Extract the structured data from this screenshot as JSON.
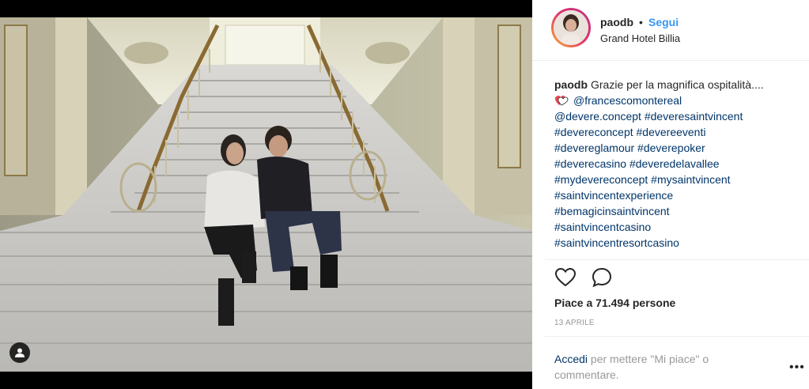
{
  "post": {
    "username": "paodb",
    "separator": "•",
    "follow_label": "Segui",
    "location": "Grand Hotel Billia"
  },
  "caption": {
    "username": "paodb",
    "text": "Grazie per la magnifica ospitalità....",
    "mention": "@francescomontereal",
    "hashtag_lines": [
      "@devere.concept #deveresaintvincent",
      "#devereconcept #devereeventi",
      "#devereglamour #deverepoker",
      "#deverecasino #deveredelavallee",
      "#mydevereconcept #mysaintvincent",
      "#saintvincentexperience",
      "#bemagicinsaintvincent",
      "#saintvincentcasino",
      "#saintvincentresortcasino"
    ]
  },
  "likes_text": "Piace a 71.494 persone",
  "date_text": "13 APRILE",
  "login": {
    "link": "Accedi",
    "text": " per mettere \"Mi piace\" o commentare."
  },
  "more_label": "•••",
  "colors": {
    "link": "#3897f0",
    "tag": "#003569",
    "heart": "#ed4956"
  },
  "icons": [
    "heart-icon",
    "comment-icon",
    "user-tag-icon",
    "heart-emoji-icon",
    "more-options-icon"
  ]
}
